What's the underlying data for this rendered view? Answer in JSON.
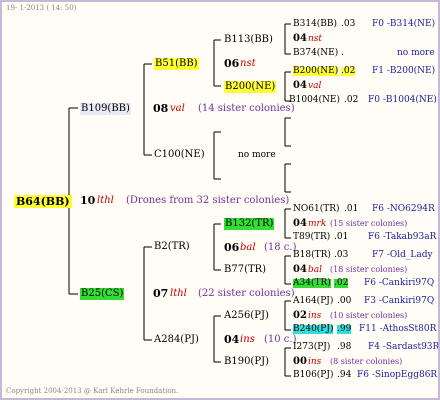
{
  "header": {
    "timestamp": "19-  1-2013 ( 14: 50)"
  },
  "footer": {
    "copyright": "Copyright 2004-2013 @ Karl Kehrle Foundation."
  },
  "root": {
    "id": "B64(BB)",
    "num": "10",
    "mark": "lthl",
    "note": "(Drones from 32 sister colonies)"
  },
  "upper": {
    "id": "B109(BB)",
    "num": "08",
    "mark": "val",
    "note": "(14 sister colonies)",
    "a": {
      "id": "B51(BB)",
      "num": "06",
      "mark": "nst",
      "c1": {
        "id": "B113(BB)",
        "r1": {
          "id": "B314(BB)",
          "n": ".03",
          "r": "F0 -B314(NE)"
        },
        "mid": {
          "num": "04",
          "mark": "nst"
        },
        "r2": {
          "id": "B374(NE)",
          "n": ".",
          "r": "no more"
        }
      },
      "c2": {
        "id": "B200(NE)",
        "r1": {
          "id": "B200(NE)",
          "n": ".02",
          "r": "F1 -B200(NE)"
        },
        "mid": {
          "num": "04",
          "mark": "val"
        },
        "r2": {
          "id": "B1004(NE)",
          "n": ".02",
          "r": "F0 -B1004(NE)"
        }
      }
    },
    "b": {
      "id": "C100(NE)",
      "nomore": "no more"
    }
  },
  "lower": {
    "id": "B25(CS)",
    "num": "07",
    "mark": "lthl",
    "note": "(22 sister colonies)",
    "a": {
      "id": "B2(TR)",
      "num": "06",
      "mark": "bal",
      "note": "(18 c.)",
      "c1": {
        "id": "B132(TR)",
        "r1": {
          "id": "NO61(TR)",
          "n": ".01",
          "r": "F6 -NO6294R"
        },
        "mid": {
          "num": "04",
          "mark": "mrk",
          "note": "(15 sister colonies)"
        },
        "r2": {
          "id": "T89(TR)",
          "n": ".01",
          "r": "F6 -Takab93aR"
        }
      },
      "c2": {
        "id": "B77(TR)",
        "r1": {
          "id": "B18(TR)",
          "n": ".03",
          "r": "F7 -Old_Lady"
        },
        "mid": {
          "num": "04",
          "mark": "bal",
          "note": "(18 sister colonies)"
        },
        "r2": {
          "id": "A34(TR)",
          "n": ".02",
          "r": "F6 -Cankiri97Q"
        }
      }
    },
    "b": {
      "id": "A284(PJ)",
      "num": "04",
      "mark": "ins",
      "note": "(10 c.)",
      "c1": {
        "id": "A256(PJ)",
        "r1": {
          "id": "A164(PJ)",
          "n": ".00",
          "r": "F3 -Cankiri97Q"
        },
        "mid": {
          "num": "02",
          "mark": "ins",
          "note": "(10 sister colonies)"
        },
        "r2": {
          "id": "B240(PJ)",
          "n": ".99",
          "r": "F11 -AthosSt80R"
        }
      },
      "c2": {
        "id": "B190(PJ)",
        "r1": {
          "id": "I273(PJ)",
          "n": ".98",
          "r": "F4 -Sardast93R"
        },
        "mid": {
          "num": "00",
          "mark": "ins",
          "note": "(8 sister colonies)"
        },
        "r2": {
          "id": "B106(PJ)",
          "n": ".94",
          "r": "F6 -SinopEgg86R"
        }
      }
    }
  }
}
